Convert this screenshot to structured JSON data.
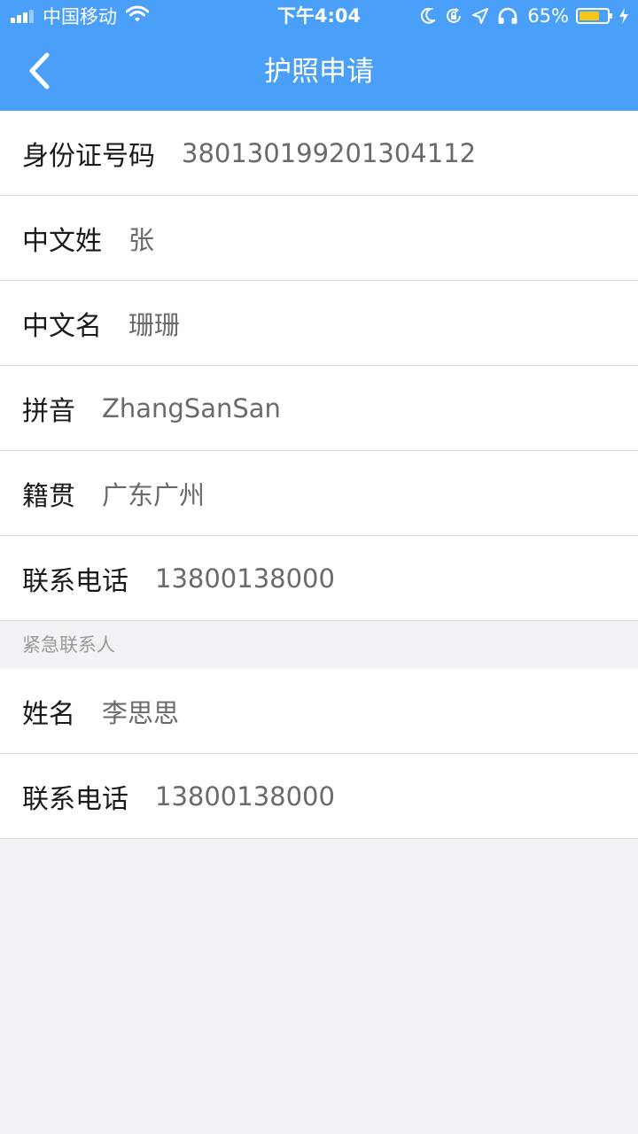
{
  "status_bar": {
    "carrier": "中国移动",
    "time": "下午4:04",
    "battery_percent": "65%",
    "battery_level": 0.65,
    "icons": [
      "signal-icon",
      "wifi-icon",
      "moon-icon",
      "orientation-lock-icon",
      "location-icon",
      "headphones-icon",
      "battery-icon",
      "charging-icon"
    ]
  },
  "nav": {
    "title": "护照申请",
    "back_icon": "chevron-left-icon"
  },
  "colors": {
    "nav_bg": "#4aa0f8",
    "page_bg": "#f2f3f7",
    "battery_fill": "#f5c518"
  },
  "applicant": {
    "rows": [
      {
        "label": "身份证号码",
        "value": "380130199201304112"
      },
      {
        "label": "中文姓",
        "value": "张"
      },
      {
        "label": "中文名",
        "value": "珊珊"
      },
      {
        "label": "拼音",
        "value": "ZhangSanSan"
      },
      {
        "label": "籍贯",
        "value": "广东广州"
      },
      {
        "label": "联系电话",
        "value": "13800138000"
      }
    ]
  },
  "emergency": {
    "header": "紧急联系人",
    "rows": [
      {
        "label": "姓名",
        "value": "李思思"
      },
      {
        "label": "联系电话",
        "value": "13800138000"
      }
    ]
  }
}
